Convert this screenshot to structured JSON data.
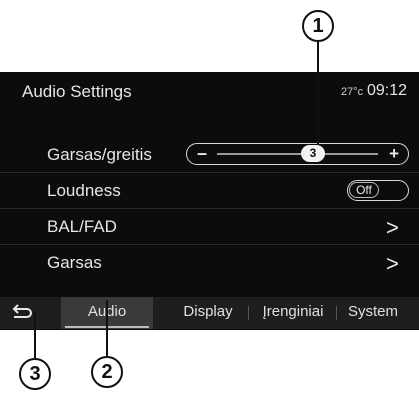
{
  "header": {
    "title": "Audio Settings",
    "temperature": "27°c",
    "time": "09:12"
  },
  "settings": {
    "sound_speed": {
      "label": "Garsas/greitis",
      "minus": "–",
      "plus": "+",
      "value": "3"
    },
    "loudness": {
      "label": "Loudness",
      "state": "Off"
    },
    "bal_fad": {
      "label": "BAL/FAD",
      "chevron": ">"
    },
    "sound": {
      "label": "Garsas",
      "chevron": ">"
    }
  },
  "tabs": [
    {
      "label": "Audio",
      "active": true
    },
    {
      "label": "Display",
      "active": false
    },
    {
      "label": "Įrenginiai",
      "active": false
    },
    {
      "label": "System",
      "active": false
    }
  ],
  "back_icon": "return-arrow-icon",
  "callouts": {
    "c1": "1",
    "c2": "2",
    "c3": "3"
  }
}
